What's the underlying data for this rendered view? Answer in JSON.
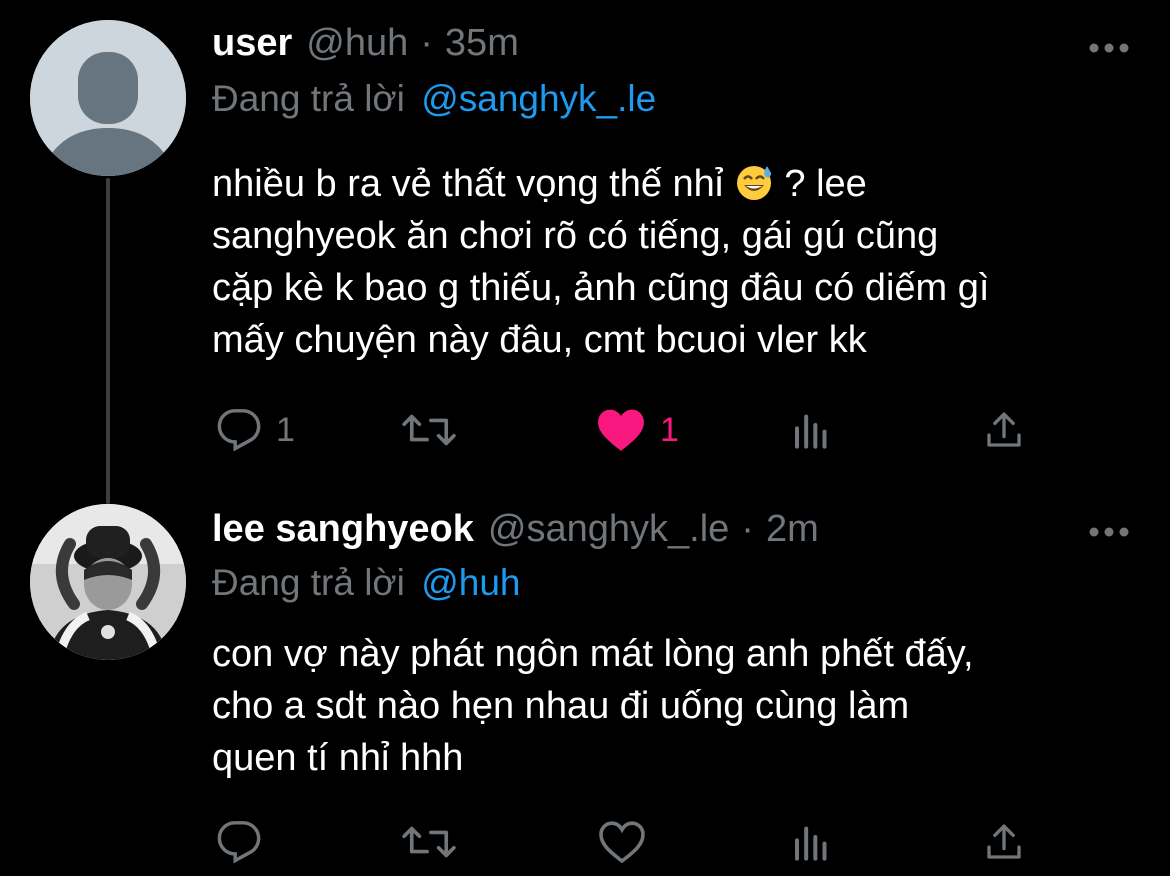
{
  "tweet1": {
    "name": "user",
    "handle": "@huh",
    "separator": "·",
    "time": "35m",
    "replying_prefix": "Đang trả lời",
    "replying_to": "@sanghyk_.le",
    "text_before_emoji": "nhiều b ra vẻ thất vọng thế nhỉ ",
    "emoji": "😅",
    "text_after_emoji": " ? lee\nsanghyeok ăn chơi rõ có tiếng, gái gú cũng\ncặp kè k bao g thiếu, ảnh cũng đâu có diếm gì\nmấy chuyện này đâu, cmt bcuoi vler kk",
    "reply_count": "1",
    "like_count": "1",
    "liked": true
  },
  "tweet2": {
    "name": "lee sanghyeok",
    "handle": "@sanghyk_.le",
    "separator": "·",
    "time": "2m",
    "replying_prefix": "Đang trả lời",
    "replying_to": "@huh",
    "text": "con vợ này phát ngôn mát lòng anh phết đấy,\ncho a sdt nào hẹn nhau đi uống cùng làm\nquen tí nhỉ hhh",
    "reply_count": "",
    "like_count": "",
    "liked": false
  },
  "colors": {
    "background": "#000000",
    "secondary_text": "#71767b",
    "mention": "#1d9bf0",
    "like": "#f91880",
    "thread_line": "#3b3f43"
  },
  "icons": [
    "reply-icon",
    "retweet-icon",
    "like-icon",
    "analytics-icon",
    "share-icon",
    "more-icon"
  ]
}
